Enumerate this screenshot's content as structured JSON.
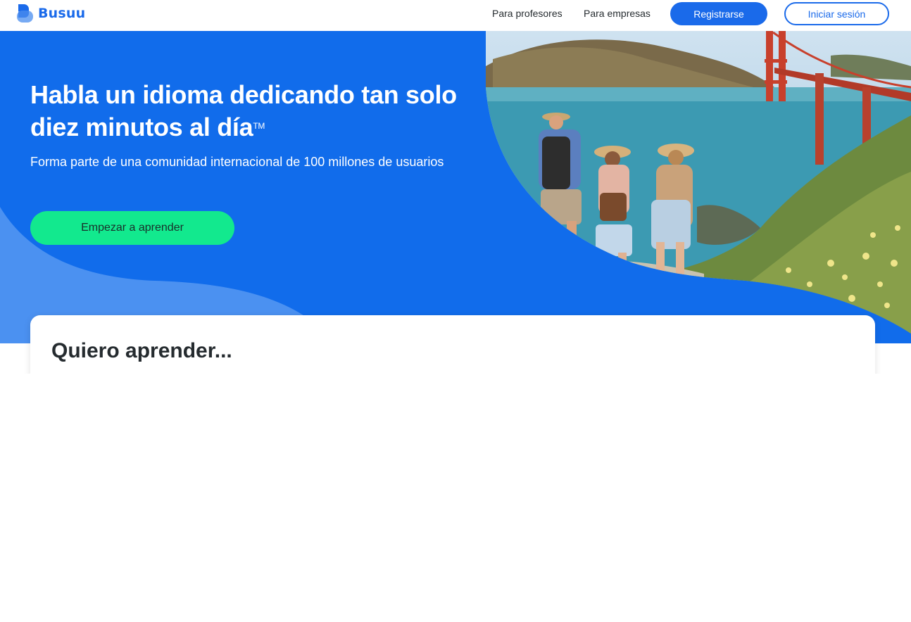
{
  "brand": {
    "name": "Busuu",
    "color": "#1a6aea"
  },
  "nav": {
    "teachers": "Para profesores",
    "business": "Para empresas",
    "register": "Registrarse",
    "login": "Iniciar sesión"
  },
  "hero": {
    "title": "Habla un idioma dedicando tan solo diez minutos al día",
    "trademark": "TM",
    "subtitle": "Forma parte de una comunidad internacional de 100 millones de usuarios",
    "cta": "Empezar a aprender",
    "image_alt": "travelers-golden-gate-bridge-photo",
    "colors": {
      "background": "#116ceb",
      "cta": "#12e98e"
    }
  },
  "languages": {
    "heading": "Quiero aprender..."
  }
}
